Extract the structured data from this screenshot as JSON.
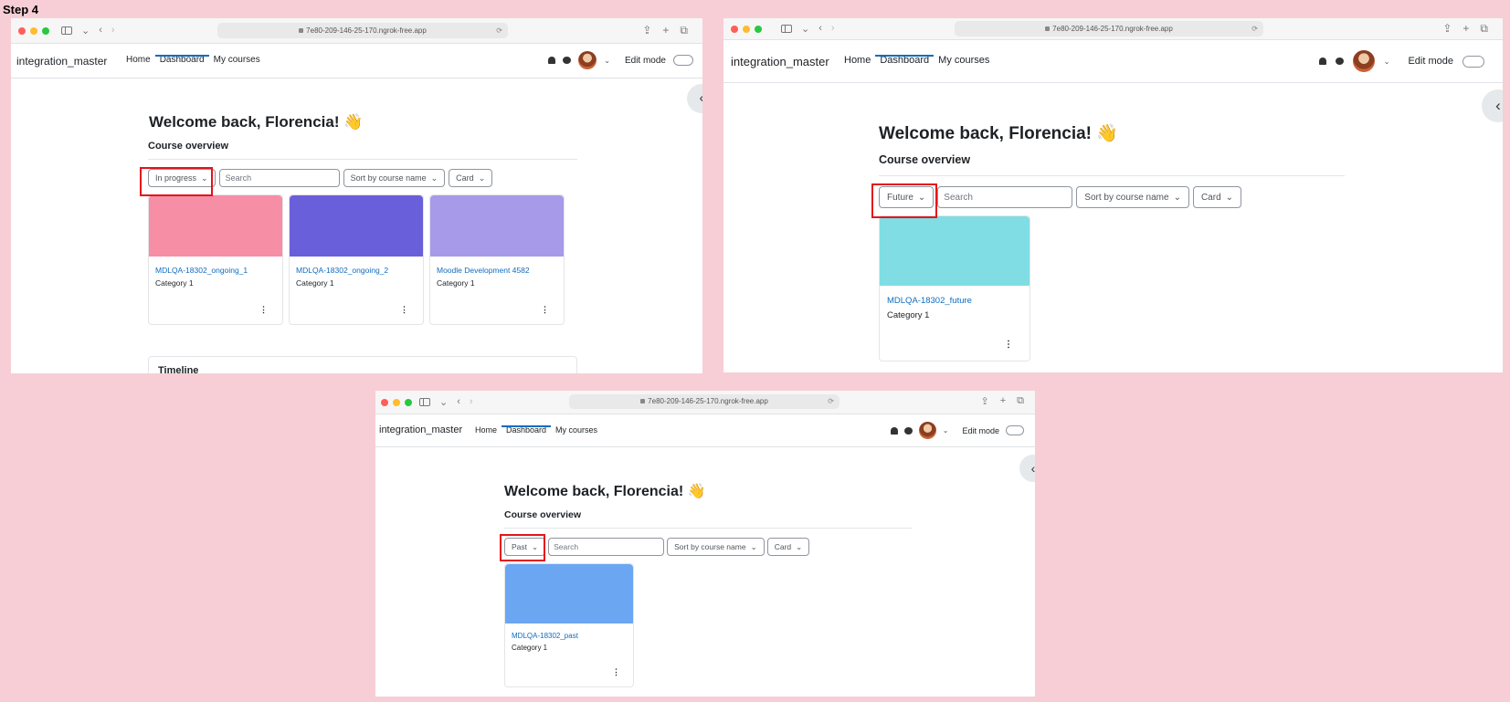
{
  "step_label": "Step 4",
  "url": "7e80-209-146-25-170.ngrok-free.app",
  "site_name": "integration_master",
  "nav": {
    "home": "Home",
    "dashboard": "Dashboard",
    "my_courses": "My courses"
  },
  "edit_mode": "Edit mode",
  "welcome": "Welcome back, Florencia! 👋",
  "course_overview": "Course overview",
  "search_placeholder": "Search",
  "sort_label": "Sort by course name",
  "view_label": "Card",
  "timeline_label": "Timeline",
  "panels": [
    {
      "filter": "In progress",
      "courses": [
        {
          "name": "MDLQA-18302_ongoing_1",
          "category": "Category 1",
          "color": "#f68ea6"
        },
        {
          "name": "MDLQA-18302_ongoing_2",
          "category": "Category 1",
          "color": "#6a5fdb"
        },
        {
          "name": "Moodle Development 4582",
          "category": "Category 1",
          "color": "#a79ae8"
        }
      ]
    },
    {
      "filter": "Future",
      "courses": [
        {
          "name": "MDLQA-18302_future",
          "category": "Category 1",
          "color": "#7fdde3"
        }
      ]
    },
    {
      "filter": "Past",
      "courses": [
        {
          "name": "MDLQA-18302_past",
          "category": "Category 1",
          "color": "#6aa6f2"
        }
      ]
    }
  ],
  "colors": {
    "highlight": "#e3141b",
    "link": "#0f6cbf",
    "background": "#f7ced6"
  }
}
